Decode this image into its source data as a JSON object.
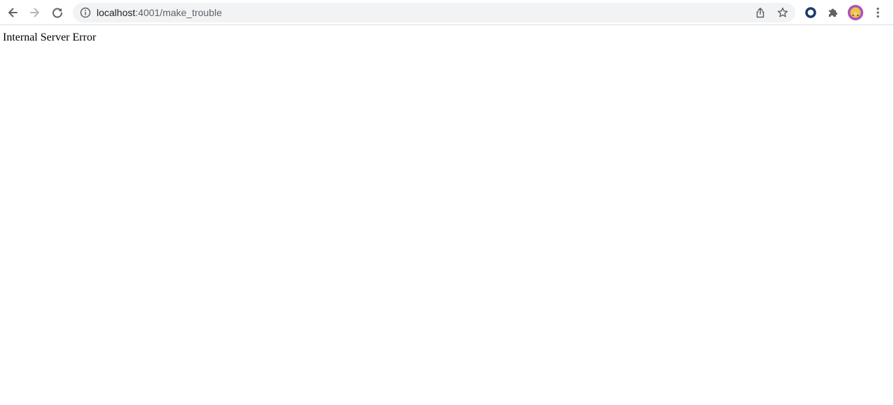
{
  "browser": {
    "url_host": "localhost",
    "url_rest": ":4001/make_trouble",
    "icons": {
      "back": "back-arrow-icon",
      "forward": "forward-arrow-icon",
      "reload": "reload-icon",
      "site_info": "info-icon",
      "share": "share-icon",
      "bookmark": "star-icon",
      "extension_1": "ring-extension-icon",
      "extensions": "puzzle-icon",
      "profile": "avatar",
      "menu": "kebab-menu-icon"
    },
    "colors": {
      "toolbar_bg": "#ffffff",
      "omnibox_bg": "#f1f3f4",
      "icon": "#5f6368",
      "extension_ring": "#1a3a6b",
      "avatar_bg": "#b04fbf"
    }
  },
  "page": {
    "body_text": "Internal Server Error"
  }
}
